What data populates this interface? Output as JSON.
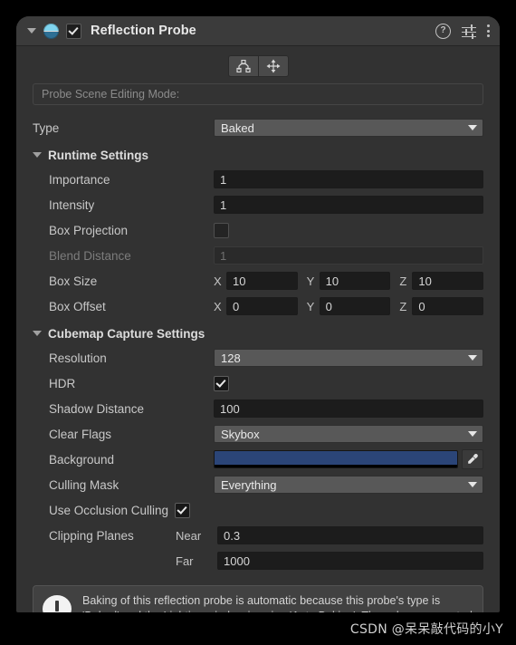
{
  "component": {
    "title": "Reflection Probe",
    "enabled_checkbox": true,
    "icons": {
      "foldout": "triangle-down-icon",
      "probe": "reflection-probe-icon",
      "help": "?",
      "presets": "preset-sliders-icon",
      "menu": "kebab-menu-icon"
    }
  },
  "toolbar": {
    "edit_bounds_label": "edit-bounds-icon",
    "move_probe_label": "move-probe-icon"
  },
  "scene_editing": {
    "label": "Probe Scene Editing Mode:"
  },
  "type_row": {
    "label": "Type",
    "value": "Baked"
  },
  "runtime_settings": {
    "title": "Runtime Settings",
    "importance": {
      "label": "Importance",
      "value": "1"
    },
    "intensity": {
      "label": "Intensity",
      "value": "1"
    },
    "box_projection": {
      "label": "Box Projection",
      "checked": false
    },
    "blend_distance": {
      "label": "Blend Distance",
      "value": "1",
      "disabled": true
    },
    "box_size": {
      "label": "Box Size",
      "axes": [
        "X",
        "Y",
        "Z"
      ],
      "values": [
        "10",
        "10",
        "10"
      ]
    },
    "box_offset": {
      "label": "Box Offset",
      "axes": [
        "X",
        "Y",
        "Z"
      ],
      "values": [
        "0",
        "0",
        "0"
      ]
    }
  },
  "cubemap_settings": {
    "title": "Cubemap Capture Settings",
    "resolution": {
      "label": "Resolution",
      "value": "128"
    },
    "hdr": {
      "label": "HDR",
      "checked": true
    },
    "shadow_distance": {
      "label": "Shadow Distance",
      "value": "100"
    },
    "clear_flags": {
      "label": "Clear Flags",
      "value": "Skybox"
    },
    "background": {
      "label": "Background",
      "color": "#2b4578",
      "eyedropper": "eyedropper-icon"
    },
    "culling_mask": {
      "label": "Culling Mask",
      "value": "Everything"
    },
    "use_occlusion_culling": {
      "label": "Use Occlusion Culling",
      "checked": true
    },
    "clipping_planes": {
      "label": "Clipping Planes",
      "near_label": "Near",
      "near_value": "0.3",
      "far_label": "Far",
      "far_value": "1000"
    }
  },
  "info_box": {
    "text": "Baking of this reflection probe is automatic because this probe's type is 'Baked' and the Lighting window is using 'Auto Baking'. The cubemap created is stored in the GI cache."
  },
  "watermark": {
    "text": "CSDN @呆呆敲代码的小Y"
  },
  "colors": {
    "panel_bg": "#323232",
    "header_bg": "#3b3b3b",
    "field_bg": "#1c1c1c",
    "dropdown_bg": "#585858",
    "accent_blue": "#2b4578"
  }
}
